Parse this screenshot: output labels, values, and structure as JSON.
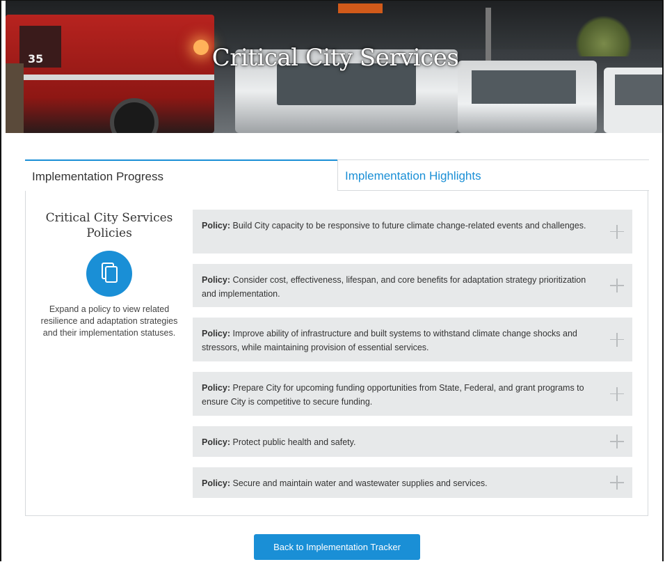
{
  "hero": {
    "title": "Critical City Services"
  },
  "tabs": [
    {
      "label": "Implementation Progress",
      "active": true
    },
    {
      "label": "Implementation Highlights",
      "active": false
    }
  ],
  "sidebar": {
    "title": "Critical City Services Policies",
    "icon": "documents-icon",
    "description": "Expand a policy to view related resilience and adaptation strategies and their implementation statuses."
  },
  "policies": [
    {
      "label": "Policy:",
      "text": "Build City capacity to be responsive to future climate change-related events and challenges."
    },
    {
      "label": "Policy:",
      "text": "Consider cost, effectiveness, lifespan, and core benefits for adaptation strategy prioritization and implementation."
    },
    {
      "label": "Policy:",
      "text": "Improve ability of infrastructure and built systems to withstand climate change shocks and stressors, while maintaining provision of essential services."
    },
    {
      "label": "Policy:",
      "text": "Prepare City for upcoming funding opportunities from State, Federal, and grant programs to ensure City is competitive to secure funding."
    },
    {
      "label": "Policy:",
      "text": "Protect public health and safety."
    },
    {
      "label": "Policy:",
      "text": "Secure and maintain water and wastewater supplies and services."
    }
  ],
  "back_button": {
    "label": "Back to Implementation Tracker"
  },
  "colors": {
    "accent": "#1a8fd6",
    "policy_bg": "#e7e9ea"
  }
}
